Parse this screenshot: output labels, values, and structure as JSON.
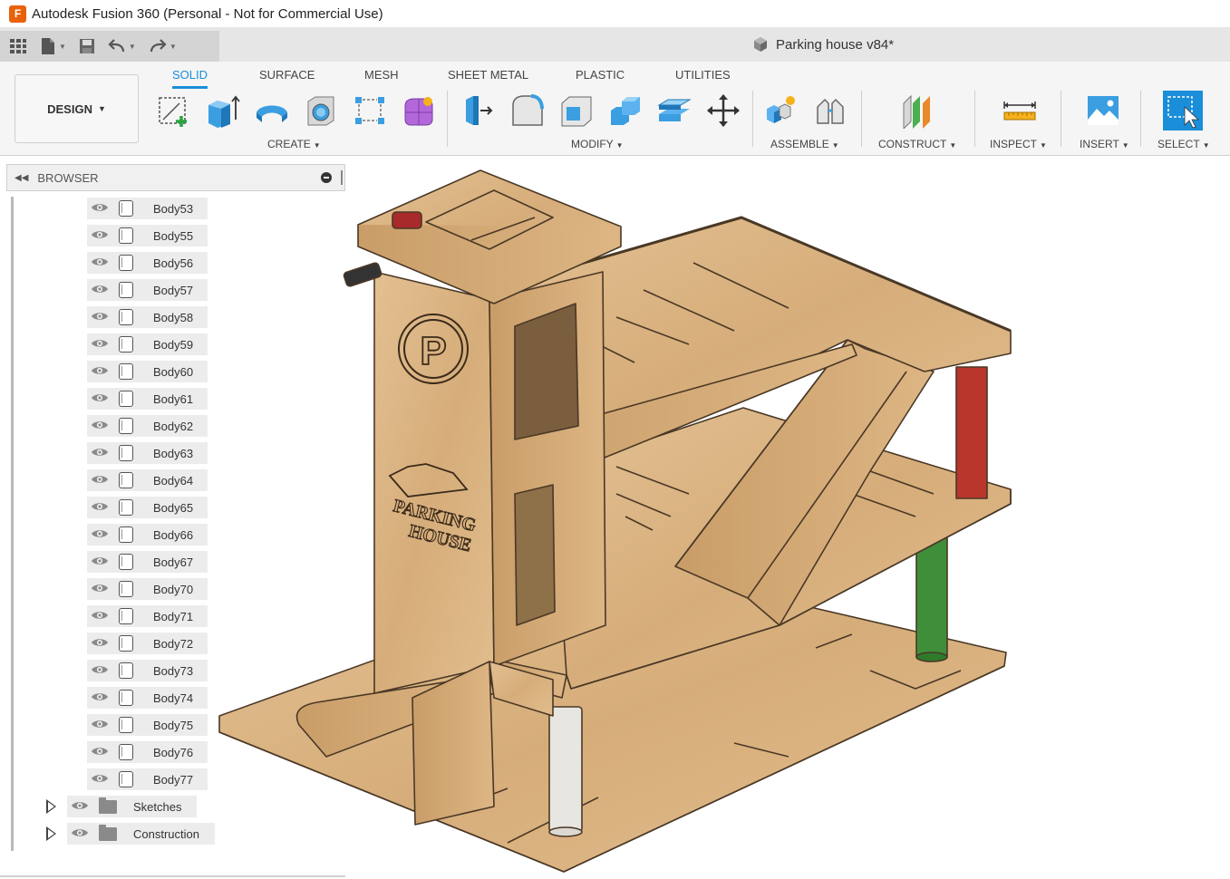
{
  "window": {
    "title": "Autodesk Fusion 360 (Personal - Not for Commercial Use)",
    "logo_letter": "F"
  },
  "document": {
    "title": "Parking house v84*"
  },
  "workspace": {
    "label": "DESIGN"
  },
  "tabs": [
    {
      "label": "SOLID",
      "active": true
    },
    {
      "label": "SURFACE"
    },
    {
      "label": "MESH"
    },
    {
      "label": "SHEET METAL"
    },
    {
      "label": "PLASTIC"
    },
    {
      "label": "UTILITIES"
    }
  ],
  "groups": {
    "create": "CREATE",
    "modify": "MODIFY",
    "assemble": "ASSEMBLE",
    "construct": "CONSTRUCT",
    "inspect": "INSPECT",
    "insert": "INSERT",
    "select": "SELECT"
  },
  "browser": {
    "title": "BROWSER",
    "bodies": [
      "Body53",
      "Body55",
      "Body56",
      "Body57",
      "Body58",
      "Body59",
      "Body60",
      "Body61",
      "Body62",
      "Body63",
      "Body64",
      "Body65",
      "Body66",
      "Body67",
      "Body70",
      "Body71",
      "Body72",
      "Body73",
      "Body74",
      "Body75",
      "Body76",
      "Body77"
    ],
    "folders": [
      "Sketches",
      "Construction"
    ]
  },
  "model": {
    "sign_letter": "P",
    "sign_line1": "PARKING",
    "sign_line2": "HOUSE"
  },
  "colors": {
    "accent": "#1a8ed8",
    "wood": "#d9b483",
    "wood_edge": "#5a4530",
    "pillar_red": "#b8362b",
    "pillar_green": "#3f8f3a",
    "pillar_white": "#e8e6e0"
  }
}
